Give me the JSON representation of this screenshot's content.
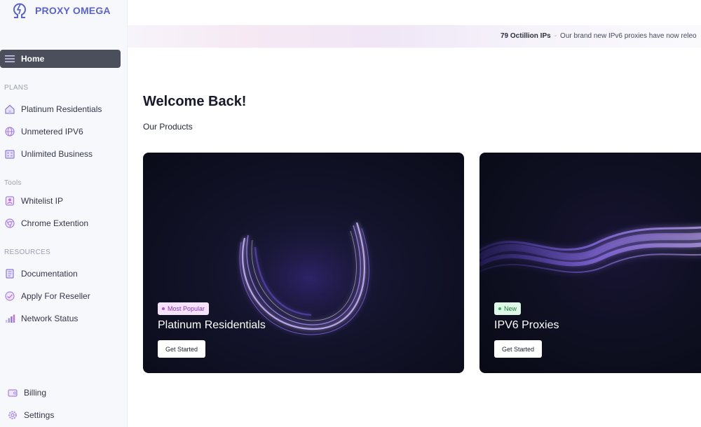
{
  "brand": {
    "name": "PROXY OMEGA",
    "accent": "#5a63c8"
  },
  "sidebar": {
    "home": {
      "label": "Home",
      "icon": "menu-icon"
    },
    "plans_label": "PLANS",
    "plans": [
      {
        "label": "Platinum Residentials",
        "icon": "home-icon"
      },
      {
        "label": "Unmetered IPV6",
        "icon": "globe-icon"
      },
      {
        "label": "Unlimited Business",
        "icon": "building-icon"
      }
    ],
    "tools_label": "Tools",
    "tools": [
      {
        "label": "Whitelist IP",
        "icon": "user-shield-icon"
      },
      {
        "label": "Chrome Extention",
        "icon": "chrome-icon"
      }
    ],
    "resources_label": "RESOURCES",
    "resources": [
      {
        "label": "Documentation",
        "icon": "book-icon"
      },
      {
        "label": "Apply For Reseller",
        "icon": "handshake-icon"
      },
      {
        "label": "Network Status",
        "icon": "signal-bars-icon"
      }
    ],
    "bottom": [
      {
        "label": "Billing",
        "icon": "wallet-icon"
      },
      {
        "label": "Settings",
        "icon": "gear-icon"
      }
    ]
  },
  "banner": {
    "highlight": "79 Octillion IPs",
    "separator": "-",
    "message": "Our brand new IPv6 proxies have now releo"
  },
  "main": {
    "title": "Welcome Back!",
    "subtitle": "Our Products",
    "products": [
      {
        "badge": "Most Popular",
        "title": "Platinum Residentials",
        "button": "Get Started"
      },
      {
        "badge": "New",
        "title": "IPV6 Proxies",
        "button": "Get Started"
      }
    ]
  },
  "colors": {
    "sidebar_bg": "#f7f8fb",
    "active_item_bg": "#4b4f5c",
    "card_bg": "#0f1022",
    "art_purple": "#8b5cf6"
  }
}
